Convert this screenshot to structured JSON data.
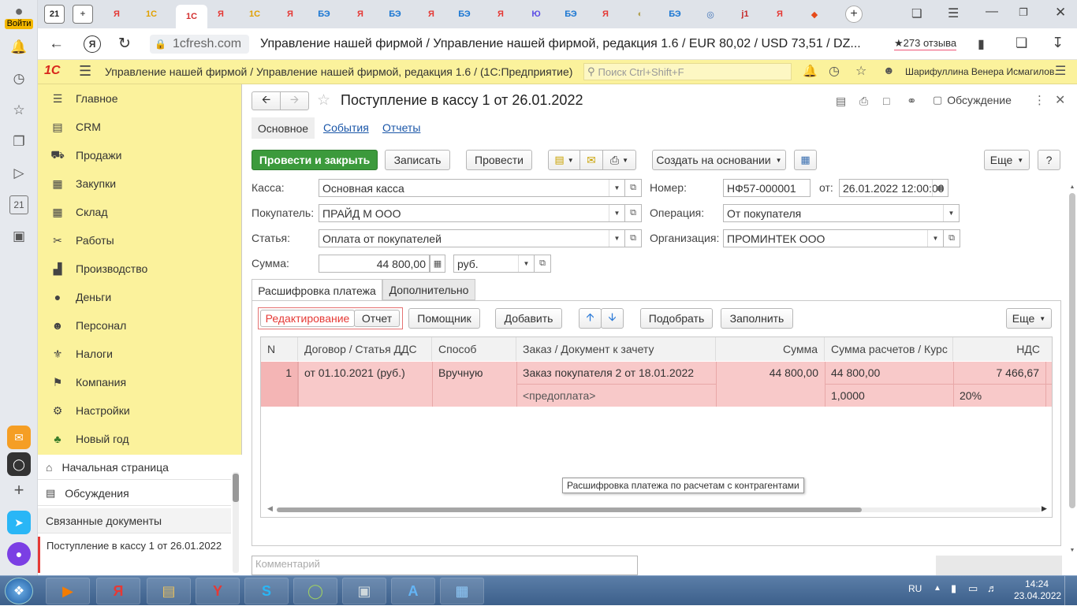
{
  "browser": {
    "login_label": "Войти",
    "tabs": [
      {
        "label": "21",
        "color": "#222222"
      },
      {
        "label": "+",
        "color": "#555555"
      },
      {
        "label": "Я",
        "color": "#e53935"
      },
      {
        "label": "1С",
        "color": "#e0a000"
      },
      {
        "label": "1C",
        "color": "#d32f2f"
      },
      {
        "label": "Я",
        "color": "#e53935"
      },
      {
        "label": "1С",
        "color": "#e0a000"
      },
      {
        "label": "Я",
        "color": "#e53935"
      },
      {
        "label": "БЭ",
        "color": "#1976d2"
      },
      {
        "label": "Я",
        "color": "#e53935"
      },
      {
        "label": "БЭ",
        "color": "#1976d2"
      },
      {
        "label": "Я",
        "color": "#e53935"
      },
      {
        "label": "БЭ",
        "color": "#1976d2"
      },
      {
        "label": "Я",
        "color": "#e53935"
      },
      {
        "label": "Ю",
        "color": "#5c4ee5"
      },
      {
        "label": "БЭ",
        "color": "#1976d2"
      },
      {
        "label": "Я",
        "color": "#e53935"
      },
      {
        "label": "◐",
        "color": "#b0a050"
      },
      {
        "label": "БЭ",
        "color": "#1976d2"
      },
      {
        "label": "◎",
        "color": "#3b6fb6"
      },
      {
        "label": "j1",
        "color": "#c62828"
      },
      {
        "label": "Я",
        "color": "#e53935"
      },
      {
        "label": "◆",
        "color": "#e64a19"
      }
    ],
    "domain": "1cfresh.com",
    "page_title": "Управление нашей фирмой / Управление нашей фирмой, редакция 1.6 / EUR 80,02 / USD 73,51 / DZ...",
    "reviews": "★273 отзыва"
  },
  "app_header": {
    "logo": "1С",
    "title": "Управление нашей фирмой / Управление нашей фирмой, редакция 1.6 / ...",
    "platform": "(1С:Предприятие)",
    "search_placeholder": "Поиск Ctrl+Shift+F",
    "user": "Шарифуллина Венера Исмагилов..."
  },
  "sidebar": {
    "items": [
      {
        "label": "Главное",
        "icon": "menu-icon"
      },
      {
        "label": "CRM",
        "icon": "crm-icon"
      },
      {
        "label": "Продажи",
        "icon": "cart-icon"
      },
      {
        "label": "Закупки",
        "icon": "purchases-icon"
      },
      {
        "label": "Склад",
        "icon": "warehouse-icon"
      },
      {
        "label": "Работы",
        "icon": "tools-icon"
      },
      {
        "label": "Производство",
        "icon": "factory-icon"
      },
      {
        "label": "Деньги",
        "icon": "money-icon"
      },
      {
        "label": "Персонал",
        "icon": "people-icon"
      },
      {
        "label": "Налоги",
        "icon": "taxes-icon"
      },
      {
        "label": "Компания",
        "icon": "flag-icon"
      },
      {
        "label": "Настройки",
        "icon": "gear-icon"
      },
      {
        "label": "Новый год",
        "icon": "tree-icon"
      }
    ],
    "home": "Начальная страница",
    "discussions": "Обсуждения",
    "related_header": "Связанные документы",
    "related_doc": "Поступление в кассу 1 от 26.01.2022"
  },
  "document": {
    "title": "Поступление в кассу 1 от 26.01.2022",
    "discussion_label": "Обсуждение",
    "tabs": [
      "Основное",
      "События",
      "Отчеты"
    ],
    "toolbar": {
      "post_close": "Провести и закрыть",
      "save": "Записать",
      "post": "Провести",
      "create_based": "Создать на основании",
      "more": "Еще",
      "help": "?"
    },
    "fields": {
      "kassa_label": "Касса:",
      "kassa_value": "Основная касса",
      "buyer_label": "Покупатель:",
      "buyer_value": "ПРАЙД М ООО",
      "article_label": "Статья:",
      "article_value": "Оплата от покупателей",
      "sum_label": "Сумма:",
      "sum_value": "44 800,00",
      "currency_value": "руб.",
      "number_label": "Номер:",
      "number_value": "НФ57-000001",
      "date_label": "от:",
      "date_value": "26.01.2022 12:00:00",
      "operation_label": "Операция:",
      "operation_value": "От покупателя",
      "org_label": "Организация:",
      "org_value": "ПРОМИНТЕК ООО",
      "comment_placeholder": "Комментарий"
    },
    "subtabs": [
      "Расшифровка платежа",
      "Дополнительно"
    ],
    "subtoolbar": {
      "edit": "Редактирование",
      "report": "Отчет",
      "helper": "Помощник",
      "add": "Добавить",
      "pick": "Подобрать",
      "fill": "Заполнить",
      "more": "Еще"
    },
    "table": {
      "columns": [
        "N",
        "Договор / Статья ДДС",
        "Способ",
        "Заказ / Документ к зачету",
        "Сумма",
        "Сумма расчетов / Курс",
        "НДС"
      ],
      "rows": [
        {
          "n": "1",
          "contract": "от 01.10.2021 (руб.)",
          "method": "Вручную",
          "order": "Заказ покупателя 2 от 18.01.2022",
          "order_sub": "<предоплата>",
          "sum": "44 800,00",
          "settlement_sum": "44 800,00",
          "rate": "1,0000",
          "vat": "7 466,67",
          "vat_rate": "20%"
        }
      ]
    },
    "tooltip": "Расшифровка платежа по расчетам с контрагентами"
  },
  "taskbar": {
    "lang": "RU",
    "time": "14:24",
    "date": "23.04.2022"
  },
  "colors": {
    "sidebar_bg": "#fbf29c",
    "selected_row": "#f8c9c9",
    "primary_button": "#3c9a3c",
    "link": "#1a56a8",
    "accent_red": "#e53935"
  }
}
